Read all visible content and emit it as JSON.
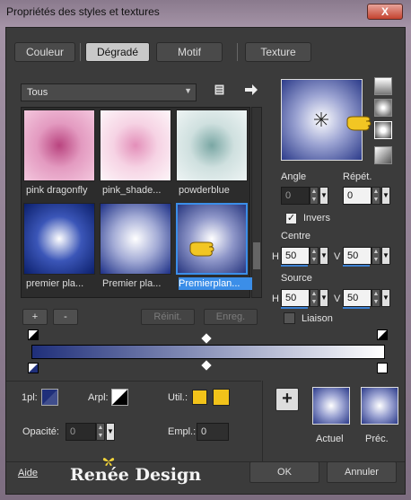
{
  "window": {
    "title": "Propriétés des styles et textures",
    "close": "X"
  },
  "tabs": [
    {
      "label": "Couleur",
      "active": false
    },
    {
      "label": "Dégradé",
      "active": true
    },
    {
      "label": "Motif",
      "active": false
    },
    {
      "label": "Texture",
      "active": false
    }
  ],
  "category_select": {
    "value": "Tous"
  },
  "gradients": [
    {
      "label": "pink dragonfly",
      "colors": [
        "#b9447f",
        "#e39ac0",
        "#f3c6dd"
      ]
    },
    {
      "label": "pink_shade...",
      "colors": [
        "#e38fb9",
        "#f6d3e4",
        "#fdf5f8"
      ]
    },
    {
      "label": "powderblue",
      "colors": [
        "#7aa7a4",
        "#cfe0df",
        "#eef4f4"
      ]
    },
    {
      "label": "premier pla...",
      "colors": [
        "#ffffff",
        "#3b56b8",
        "#0b1f6b"
      ]
    },
    {
      "label": "Premier pla...",
      "colors": [
        "#ffffff",
        "#a4acd6",
        "#1c2f86"
      ]
    },
    {
      "label": "Premierplan...",
      "colors": [
        "#ffffff",
        "#8f97c9",
        "#27367f"
      ],
      "selected": true
    }
  ],
  "list_buttons": {
    "add": "+",
    "remove": "-",
    "reset": "Réinit.",
    "save": "Enreg."
  },
  "preview": {
    "colors": [
      "#ffffff",
      "#9ba3d2",
      "#2c3b8a"
    ]
  },
  "angle": {
    "label": "Angle",
    "value": "0"
  },
  "repeat": {
    "label": "Répét.",
    "value": "0"
  },
  "invert": {
    "label": "Invers",
    "checked": true
  },
  "center": {
    "label": "Centre",
    "h_label": "H",
    "h": "50",
    "v_label": "V",
    "v": "50"
  },
  "source": {
    "label": "Source",
    "h_label": "H",
    "h": "50",
    "v_label": "V",
    "v": "50"
  },
  "link": {
    "label": "Liaison",
    "checked": false
  },
  "gradient_bar": {
    "from": "#1f2f7a",
    "to": "#ffffff"
  },
  "bottom": {
    "first_plane_label": "1pl:",
    "arrow_plane_label": "Arpl:",
    "use_label": "Util.:",
    "use_color_1": "#f2c31a",
    "use_color_2": "#f2c31a",
    "opacity_label": "Opacité:",
    "opacity_value": "0",
    "placement_label": "Empl.:",
    "placement_value": "0",
    "current_label": "Actuel",
    "previous_label": "Préc.",
    "add": "+"
  },
  "footer": {
    "help": "Aide",
    "watermark": "Renée Design",
    "ok": "OK",
    "cancel": "Annuler"
  }
}
